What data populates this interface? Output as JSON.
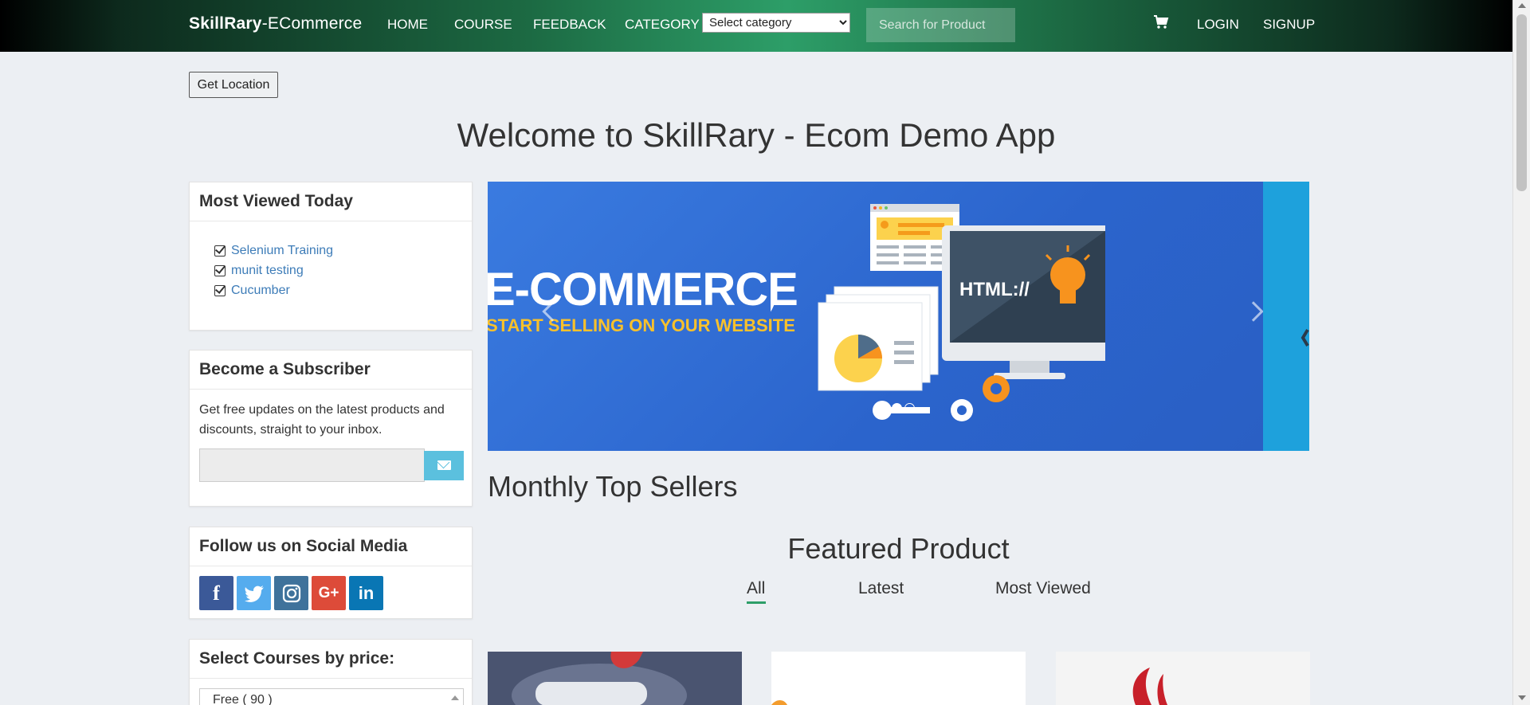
{
  "navbar": {
    "brand_bold": "SkillRary",
    "brand_rest": "-ECommerce",
    "links": [
      "HOME",
      "COURSE",
      "FEEDBACK",
      "CATEGORY"
    ],
    "category_select": "Select category",
    "search_placeholder": "Search for Product",
    "login": "LOGIN",
    "signup": "SIGNUP"
  },
  "location_button": "Get Location",
  "welcome_title": "Welcome to SkillRary - Ecom Demo App",
  "sidebar": {
    "most_viewed": {
      "title": "Most Viewed Today",
      "items": [
        "Selenium Training",
        "munit testing",
        "Cucumber"
      ]
    },
    "subscriber": {
      "title": "Become a Subscriber",
      "text": "Get free updates on the latest products and discounts, straight to your inbox."
    },
    "social": {
      "title": "Follow us on Social Media",
      "networks": [
        {
          "name": "facebook",
          "glyph": "f",
          "color": "#3b5998"
        },
        {
          "name": "twitter",
          "glyph": "t",
          "color": "#55acee"
        },
        {
          "name": "instagram",
          "glyph": "◎",
          "color": "#3f729b"
        },
        {
          "name": "google-plus",
          "glyph": "G+",
          "color": "#dd4b39"
        },
        {
          "name": "linkedin",
          "glyph": "in",
          "color": "#0976b4"
        }
      ]
    },
    "price": {
      "title": "Select Courses by price:",
      "first_option": "Free ( 90 )"
    }
  },
  "carousel": {
    "title": "E-COMMERCE",
    "subtitle": "START SELLING ON YOUR WEBSITE",
    "graphic_label": "HTML://",
    "dot_count": 3,
    "active_dot": 2
  },
  "monthly_title": "Monthly Top Sellers",
  "featured": {
    "title": "Featured Product",
    "tabs": [
      "All",
      "Latest",
      "Most Viewed"
    ],
    "active_tab": "All"
  },
  "colors": {
    "accent_green": "#2d9e68",
    "link_blue": "#3d7cb8",
    "subscribe_button": "#5bc0de",
    "carousel_blue": "#2f6fd6"
  }
}
